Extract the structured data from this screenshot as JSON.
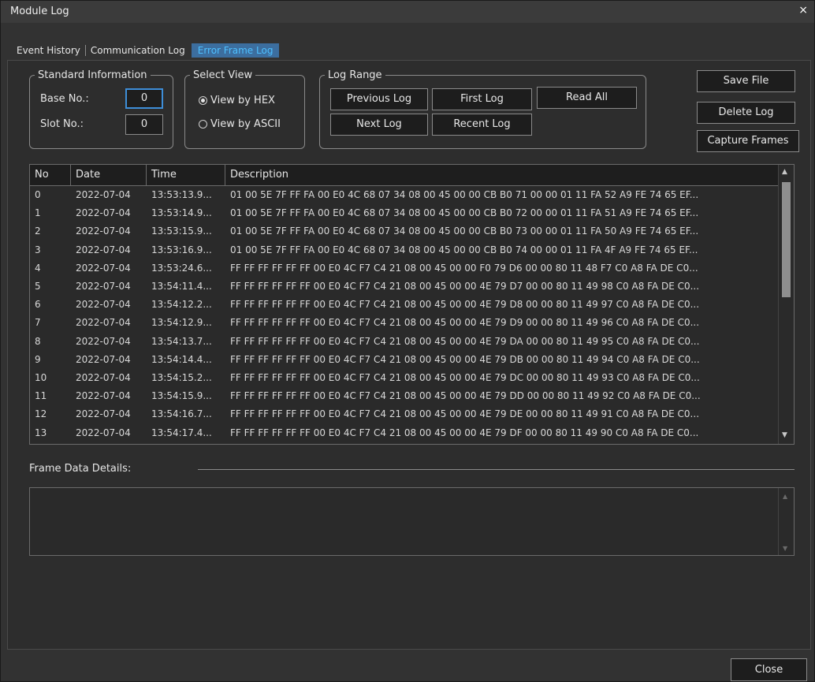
{
  "window": {
    "title": "Module Log",
    "close_glyph": "×"
  },
  "tabs": [
    {
      "label": "Event History"
    },
    {
      "label": "Communication Log"
    },
    {
      "label": "Error Frame Log"
    }
  ],
  "standard_info": {
    "legend": "Standard Information",
    "base_label": "Base No.:",
    "base_value": "0",
    "slot_label": "Slot No.:",
    "slot_value": "0"
  },
  "select_view": {
    "legend": "Select View",
    "options": [
      {
        "label": "View by HEX",
        "selected": true
      },
      {
        "label": "View by ASCII",
        "selected": false
      }
    ]
  },
  "log_range": {
    "legend": "Log Range",
    "previous": "Previous Log",
    "first": "First Log",
    "read_all": "Read All",
    "next": "Next Log",
    "recent": "Recent Log"
  },
  "actions": {
    "save": "Save File",
    "delete": "Delete Log",
    "capture": "Capture Frames"
  },
  "table": {
    "columns": [
      "No",
      "Date",
      "Time",
      "Description"
    ],
    "rows": [
      [
        "0",
        "2022-07-04",
        "13:53:13.9...",
        "01 00 5E 7F FF FA 00 E0 4C 68 07 34 08 00 45 00 00 CB B0 71 00 00 01 11 FA 52 A9 FE 74 65 EF..."
      ],
      [
        "1",
        "2022-07-04",
        "13:53:14.9...",
        "01 00 5E 7F FF FA 00 E0 4C 68 07 34 08 00 45 00 00 CB B0 72 00 00 01 11 FA 51 A9 FE 74 65 EF..."
      ],
      [
        "2",
        "2022-07-04",
        "13:53:15.9...",
        "01 00 5E 7F FF FA 00 E0 4C 68 07 34 08 00 45 00 00 CB B0 73 00 00 01 11 FA 50 A9 FE 74 65 EF..."
      ],
      [
        "3",
        "2022-07-04",
        "13:53:16.9...",
        "01 00 5E 7F FF FA 00 E0 4C 68 07 34 08 00 45 00 00 CB B0 74 00 00 01 11 FA 4F A9 FE 74 65 EF..."
      ],
      [
        "4",
        "2022-07-04",
        "13:53:24.6...",
        "FF FF FF FF FF FF 00 E0 4C F7 C4 21 08 00 45 00 00 F0 79 D6 00 00 80 11 48 F7 C0 A8 FA DE C0..."
      ],
      [
        "5",
        "2022-07-04",
        "13:54:11.4...",
        "FF FF FF FF FF FF 00 E0 4C F7 C4 21 08 00 45 00 00 4E 79 D7 00 00 80 11 49 98 C0 A8 FA DE C0..."
      ],
      [
        "6",
        "2022-07-04",
        "13:54:12.2...",
        "FF FF FF FF FF FF 00 E0 4C F7 C4 21 08 00 45 00 00 4E 79 D8 00 00 80 11 49 97 C0 A8 FA DE C0..."
      ],
      [
        "7",
        "2022-07-04",
        "13:54:12.9...",
        "FF FF FF FF FF FF 00 E0 4C F7 C4 21 08 00 45 00 00 4E 79 D9 00 00 80 11 49 96 C0 A8 FA DE C0..."
      ],
      [
        "8",
        "2022-07-04",
        "13:54:13.7...",
        "FF FF FF FF FF FF 00 E0 4C F7 C4 21 08 00 45 00 00 4E 79 DA 00 00 80 11 49 95 C0 A8 FA DE C0..."
      ],
      [
        "9",
        "2022-07-04",
        "13:54:14.4...",
        "FF FF FF FF FF FF 00 E0 4C F7 C4 21 08 00 45 00 00 4E 79 DB 00 00 80 11 49 94 C0 A8 FA DE C0..."
      ],
      [
        "10",
        "2022-07-04",
        "13:54:15.2...",
        "FF FF FF FF FF FF 00 E0 4C F7 C4 21 08 00 45 00 00 4E 79 DC 00 00 80 11 49 93 C0 A8 FA DE C0..."
      ],
      [
        "11",
        "2022-07-04",
        "13:54:15.9...",
        "FF FF FF FF FF FF 00 E0 4C F7 C4 21 08 00 45 00 00 4E 79 DD 00 00 80 11 49 92 C0 A8 FA DE C0..."
      ],
      [
        "12",
        "2022-07-04",
        "13:54:16.7...",
        "FF FF FF FF FF FF 00 E0 4C F7 C4 21 08 00 45 00 00 4E 79 DE 00 00 80 11 49 91 C0 A8 FA DE C0..."
      ],
      [
        "13",
        "2022-07-04",
        "13:54:17.4...",
        "FF FF FF FF FF FF 00 E0 4C F7 C4 21 08 00 45 00 00 4E 79 DF 00 00 80 11 49 90 C0 A8 FA DE C0..."
      ]
    ]
  },
  "frame_details": {
    "label": "Frame Data Details:"
  },
  "footer": {
    "close": "Close"
  },
  "colors": {
    "active_tab_text": "#4ec0ff",
    "active_tab_bg": "#3c6e9f",
    "focus_border": "#3e8ed8"
  }
}
